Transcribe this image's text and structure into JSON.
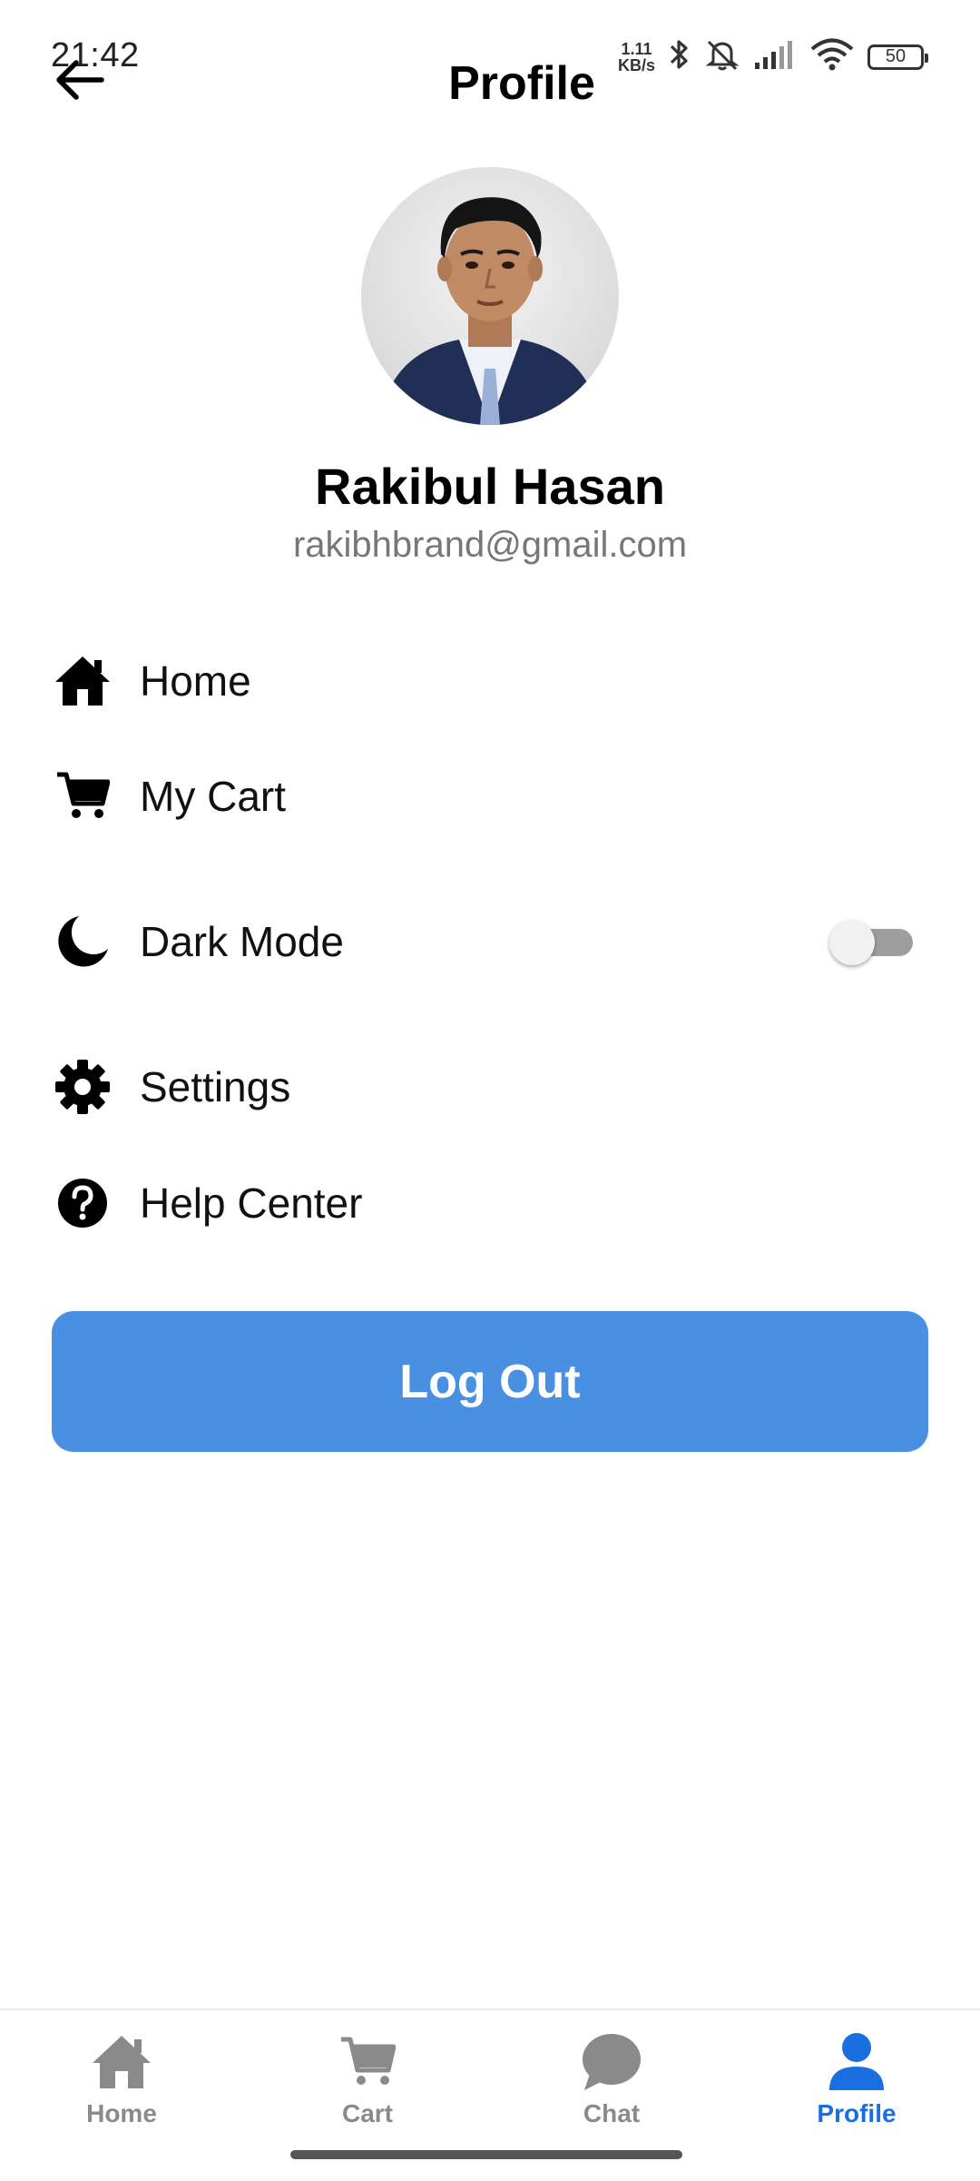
{
  "status_bar": {
    "time": "21:42",
    "net_speed_value": "1.11",
    "net_speed_unit": "KB/s",
    "battery": "50",
    "icons": [
      "bluetooth-icon",
      "mute-icon",
      "signal-icon",
      "wifi-icon",
      "battery-icon"
    ]
  },
  "header": {
    "back_icon": "arrow-left-icon",
    "title": "Profile"
  },
  "profile": {
    "name": "Rakibul Hasan",
    "email": "rakibhbrand@gmail.com"
  },
  "menu": {
    "items": [
      {
        "label": "Home",
        "icon": "home-icon"
      },
      {
        "label": "My Cart",
        "icon": "cart-icon"
      },
      {
        "label": "Dark Mode",
        "icon": "moon-icon",
        "toggle_on": false
      },
      {
        "label": "Settings",
        "icon": "gear-icon"
      },
      {
        "label": "Help Center",
        "icon": "help-circle-icon"
      }
    ]
  },
  "logout": {
    "label": "Log Out"
  },
  "bottom_nav": {
    "items": [
      {
        "label": "Home",
        "icon": "home-icon",
        "active": false
      },
      {
        "label": "Cart",
        "icon": "cart-icon",
        "active": false
      },
      {
        "label": "Chat",
        "icon": "chat-bubble-icon",
        "active": false
      },
      {
        "label": "Profile",
        "icon": "person-icon",
        "active": true
      }
    ]
  },
  "colors": {
    "accent": "#4a90e2",
    "nav_active": "#1a6fe0",
    "nav_inactive": "#8a8a8a"
  }
}
